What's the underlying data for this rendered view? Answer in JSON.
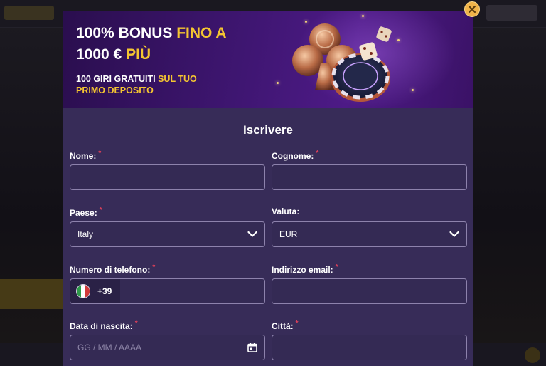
{
  "banner": {
    "line1_a": "100% BONUS ",
    "line1_b": "FINO A",
    "line2_a": "1000 € ",
    "line2_b": "PIÙ",
    "sub1_a": "100 GIRI GRATUITI ",
    "sub1_b": "SUL TUO",
    "sub2": "PRIMO DEPOSITO"
  },
  "form": {
    "title": "Iscrivere",
    "required_mark": "*",
    "first_name": {
      "label": "Nome:",
      "value": ""
    },
    "last_name": {
      "label": "Cognome:",
      "value": ""
    },
    "country": {
      "label": "Paese:",
      "value": "Italy"
    },
    "currency": {
      "label": "Valuta:",
      "value": "EUR"
    },
    "phone": {
      "label": "Numero di telefono:",
      "prefix": "+39",
      "value": ""
    },
    "email": {
      "label": "Indirizzo email:",
      "value": ""
    },
    "birth_date": {
      "label": "Data di nascita:",
      "placeholder": "GG / MM / AAAA"
    },
    "city": {
      "label": "Città:",
      "value": ""
    }
  },
  "icons": {
    "close": "close-icon",
    "dropdown": "chevron-down-icon",
    "calendar": "calendar-icon",
    "flag": "italy-flag-icon"
  },
  "colors": {
    "accent": "#f4c531",
    "modal_bg": "#372c58",
    "required": "#e0405a",
    "close_button": "#f0b44a"
  }
}
